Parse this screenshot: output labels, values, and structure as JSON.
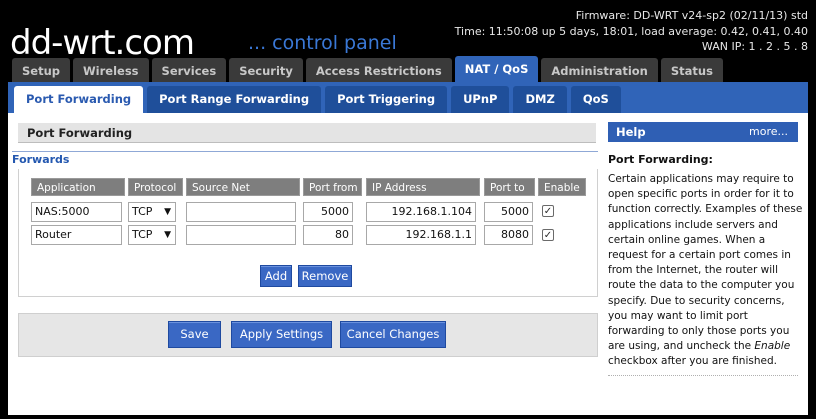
{
  "header": {
    "logo_main": "dd-wrt.com",
    "logo_sub": "... control panel",
    "firmware": "Firmware: DD-WRT v24-sp2 (02/11/13) std",
    "time": "Time: 11:50:08 up 5 days, 18:01, load average: 0.42, 0.41, 0.40",
    "wan_ip": "WAN IP: 1 . 2 . 5 . 8"
  },
  "main_tabs": [
    "Setup",
    "Wireless",
    "Services",
    "Security",
    "Access Restrictions",
    "NAT / QoS",
    "Administration",
    "Status"
  ],
  "active_main_tab": "NAT / QoS",
  "sub_tabs": [
    "Port Forwarding",
    "Port Range Forwarding",
    "Port Triggering",
    "UPnP",
    "DMZ",
    "QoS"
  ],
  "active_sub_tab": "Port Forwarding",
  "section_title": "Port Forwarding",
  "forwards_legend": "Forwards",
  "table": {
    "headers": [
      "Application",
      "Protocol",
      "Source Net",
      "Port from",
      "IP Address",
      "Port to",
      "Enable"
    ],
    "rows": [
      {
        "application": "NAS:5000",
        "protocol": "TCP",
        "source_net": "",
        "port_from": "5000",
        "ip_address": "192.168.1.104",
        "port_to": "5000",
        "enabled": "true"
      },
      {
        "application": "Router",
        "protocol": "TCP",
        "source_net": "",
        "port_from": "80",
        "ip_address": "192.168.1.1",
        "port_to": "8080",
        "enabled": "true"
      }
    ]
  },
  "buttons": {
    "add": "Add",
    "remove": "Remove",
    "save": "Save",
    "apply": "Apply Settings",
    "cancel": "Cancel Changes"
  },
  "help": {
    "header": "Help",
    "more": "more...",
    "title": "Port Forwarding:",
    "text_before": "Certain applications may require to open specific ports in order for it to function correctly. Examples of these applications include servers and certain online games. When a request for a certain port comes in from the Internet, the router will route the data to the computer you specify. Due to security concerns, you may want to limit port forwarding to only those ports you are using, and uncheck the ",
    "text_em": "Enable",
    "text_after": " checkbox after you are finished."
  }
}
